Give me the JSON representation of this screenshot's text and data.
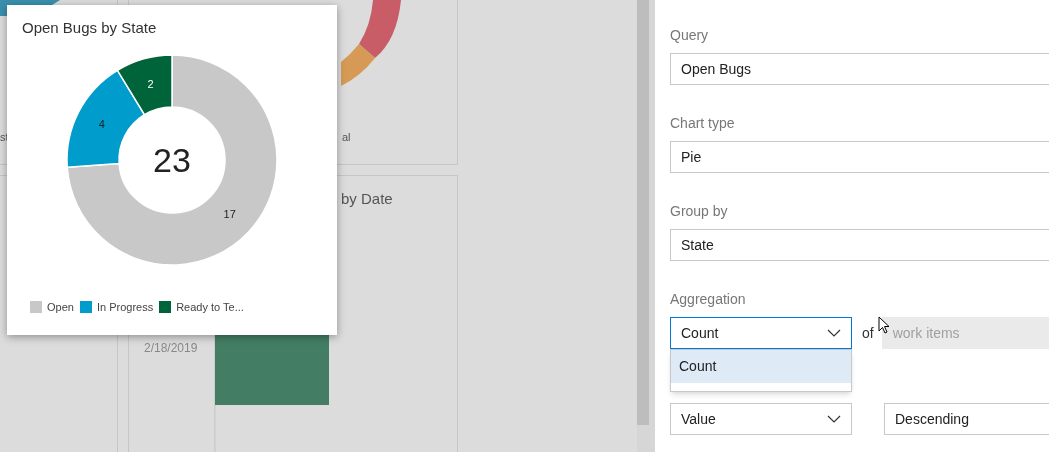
{
  "dashboard": {
    "fragments": [
      {
        "kind": "tile-left",
        "text": "st"
      },
      {
        "kind": "tile-right",
        "text": "al"
      }
    ],
    "lower_tile": {
      "title": "by Date",
      "date": "2/18/2019"
    },
    "popup": {
      "title": "Open Bugs by State",
      "total": "23",
      "chart_data": {
        "type": "donut",
        "categories": [
          "Open",
          "In Progress",
          "Ready to Te..."
        ],
        "values": [
          17,
          4,
          2
        ],
        "colors": [
          "#c8c8c8",
          "#009ccc",
          "#00643a"
        ],
        "data_labels": true
      }
    }
  },
  "settings": {
    "sections": [
      {
        "label": "Query",
        "controls": [
          {
            "kind": "select",
            "wide": true,
            "value": "Open Bugs"
          }
        ]
      },
      {
        "label": "Chart type",
        "controls": [
          {
            "kind": "select",
            "wide": true,
            "value": "Pie"
          }
        ]
      },
      {
        "label": "Group by",
        "controls": [
          {
            "kind": "select",
            "wide": true,
            "value": "State"
          }
        ]
      },
      {
        "label": "Aggregation",
        "controls": [
          {
            "kind": "select",
            "wide": false,
            "value": "Count",
            "focused": true,
            "options": [
              {
                "label": "Count",
                "selected": true
              }
            ]
          },
          {
            "kind": "text",
            "value": "of"
          },
          {
            "kind": "input",
            "placeholder": "work items",
            "disabled": true
          }
        ]
      },
      {
        "controls": [
          {
            "kind": "select",
            "wide": false,
            "value": "Value"
          },
          {
            "kind": "select",
            "wide": true,
            "value": "Descending"
          }
        ]
      }
    ]
  }
}
